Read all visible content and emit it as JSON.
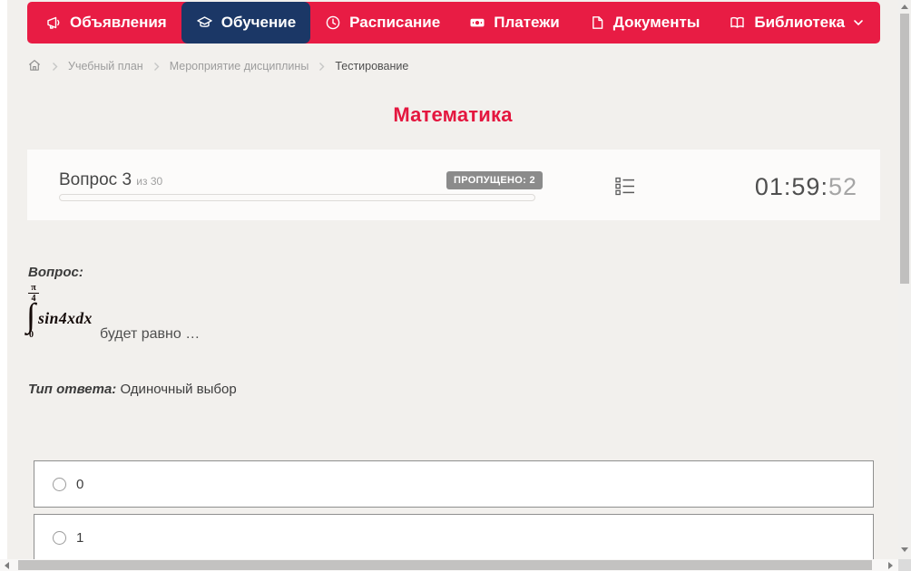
{
  "nav": {
    "items": [
      {
        "label": "Объявления",
        "icon": "megaphone-icon",
        "active": false
      },
      {
        "label": "Обучение",
        "icon": "graduation-cap-icon",
        "active": true
      },
      {
        "label": "Расписание",
        "icon": "clock-icon",
        "active": false
      },
      {
        "label": "Платежи",
        "icon": "banknote-icon",
        "active": false
      },
      {
        "label": "Документы",
        "icon": "document-icon",
        "active": false
      },
      {
        "label": "Библиотека",
        "icon": "open-book-icon",
        "active": false,
        "has_dropdown": true
      }
    ]
  },
  "breadcrumb": {
    "items": [
      "Учебный план",
      "Мероприятие дисциплины",
      "Тестирование"
    ]
  },
  "page": {
    "title": "Математика"
  },
  "quiz": {
    "question_label": "Вопрос 3",
    "question_of": "из 30",
    "skipped_badge": "ПРОПУЩЕНО: 2",
    "timer_main": "01:59:",
    "timer_seconds": "52",
    "question_heading": "Вопрос:",
    "formula": {
      "upper_num": "π",
      "upper_den": "4",
      "integral_sign": "∫",
      "integrand": "sin4xdx",
      "lower_limit": "0"
    },
    "question_tail": "будет равно …",
    "answer_type_label": "Тип ответа:",
    "answer_type_value": "Одиночный выбор",
    "options": [
      {
        "label": "0"
      },
      {
        "label": "1"
      }
    ]
  },
  "colors": {
    "accent_red": "#e81c44",
    "active_navy": "#1b3766",
    "badge_gray": "#8b8b8b",
    "page_bg": "#f2f0ed"
  }
}
